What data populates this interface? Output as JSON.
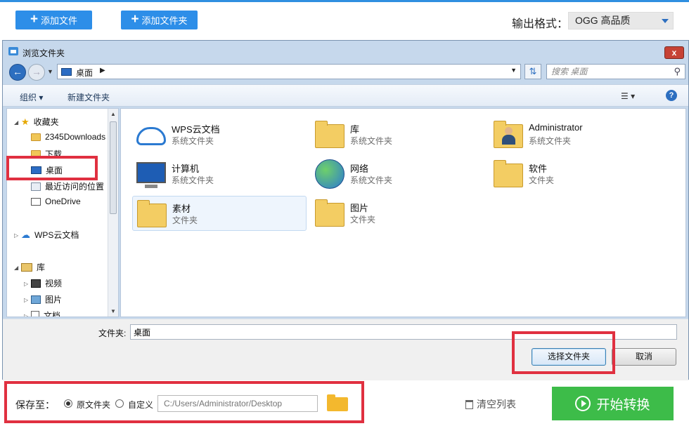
{
  "app": {
    "add_file_label": "添加文件",
    "add_folder_label": "添加文件夹",
    "output_format_label": "输出格式：",
    "output_format_value": "OGG  高品质",
    "accent_color": "#2d8ee8"
  },
  "dialog": {
    "title": "浏览文件夹",
    "close_label": "x",
    "address_path": "桌面",
    "search_placeholder": "搜索 桌面",
    "toolbar": {
      "organize_label": "组织 ▾",
      "new_folder_label": "新建文件夹",
      "help_label": "?"
    },
    "nav_tree": [
      {
        "label": "收藏夹",
        "icon": "star-icon"
      },
      {
        "label": "2345Downloads",
        "icon": "folder-icon"
      },
      {
        "label": "下载",
        "icon": "folder-icon"
      },
      {
        "label": "桌面",
        "icon": "desktop-icon"
      },
      {
        "label": "最近访问的位置",
        "icon": "recent-places-icon"
      },
      {
        "label": "OneDrive",
        "icon": "onedrive-icon"
      },
      {
        "label": "WPS云文档",
        "icon": "cloud-icon"
      },
      {
        "label": "库",
        "icon": "library-icon"
      },
      {
        "label": "视频",
        "icon": "video-icon"
      },
      {
        "label": "图片",
        "icon": "pictures-icon"
      },
      {
        "label": "文档",
        "icon": "documents-icon"
      }
    ],
    "items": [
      {
        "name": "WPS云文档",
        "type": "系统文件夹",
        "icon": "wps-cloud-icon"
      },
      {
        "name": "库",
        "type": "系统文件夹",
        "icon": "library-folder-icon"
      },
      {
        "name": "Administrator",
        "type": "系统文件夹",
        "icon": "user-folder-icon"
      },
      {
        "name": "计算机",
        "type": "系统文件夹",
        "icon": "computer-icon"
      },
      {
        "name": "网络",
        "type": "系统文件夹",
        "icon": "network-globe-icon"
      },
      {
        "name": "软件",
        "type": "文件夹",
        "icon": "folder-icon"
      },
      {
        "name": "素材",
        "type": "文件夹",
        "icon": "folder-icon"
      },
      {
        "name": "图片",
        "type": "文件夹",
        "icon": "folder-icon"
      }
    ],
    "folder_label": "文件夹:",
    "folder_value": "桌面",
    "select_button": "选择文件夹",
    "cancel_button": "取消"
  },
  "footer": {
    "save_to_label": "保存至：",
    "option_original": "原文件夹",
    "option_custom": "自定义",
    "path_placeholder": "C:/Users/Administrator/Desktop",
    "clear_list_label": "清空列表",
    "start_button": "开始转换",
    "start_color": "#3dbc49"
  }
}
